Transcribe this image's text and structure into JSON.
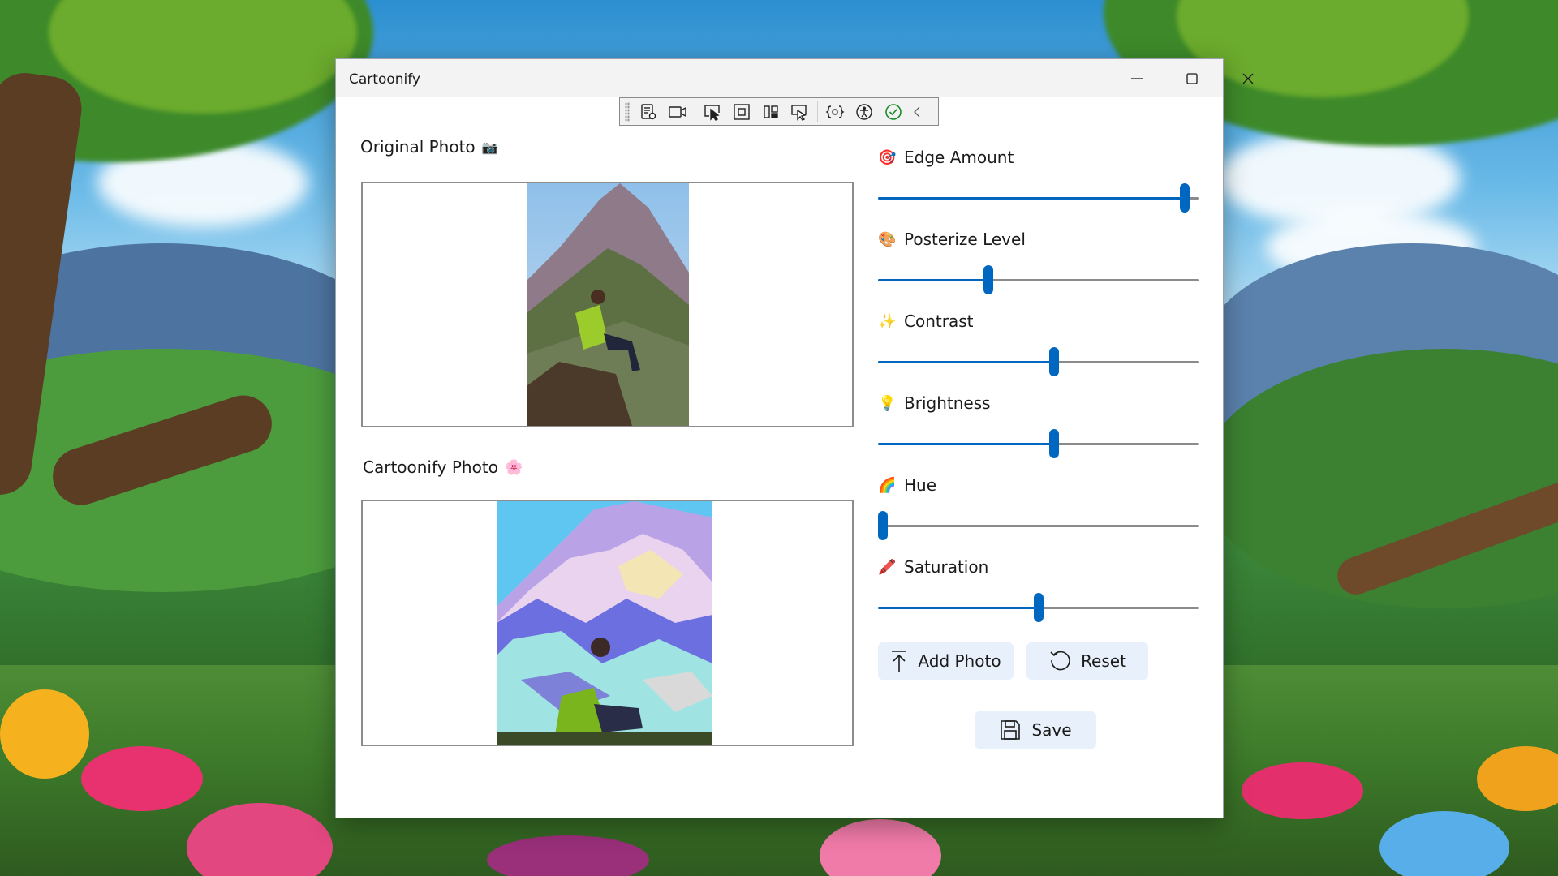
{
  "window": {
    "title": "Cartoonify",
    "controls": [
      "minimize",
      "maximize",
      "close"
    ]
  },
  "devtoolbar": {
    "icons": [
      "live-visual-tree-icon",
      "record-icon",
      "select-element-icon",
      "display-layout-adorners-icon",
      "track-focus-icon",
      "binding-failures-icon",
      "hot-reload-icon",
      "accessibility-checker-icon",
      "check-icon",
      "collapse-chevron-icon"
    ]
  },
  "original": {
    "label": "Original Photo",
    "icon": "📷"
  },
  "cartoon": {
    "label": "Cartoonify Photo",
    "icon": "🌸"
  },
  "sliders": [
    {
      "label": "Edge Amount",
      "icon": "🎯",
      "value": 0.97
    },
    {
      "label": "Posterize Level",
      "icon": "🎨",
      "value": 0.34
    },
    {
      "label": "Contrast",
      "icon": "✨",
      "value": 0.55
    },
    {
      "label": "Brightness",
      "icon": "💡",
      "value": 0.55
    },
    {
      "label": "Hue",
      "icon": "🌈",
      "value": 0.0
    },
    {
      "label": "Saturation",
      "icon": "🖍️",
      "value": 0.5
    }
  ],
  "buttons": {
    "add_photo": "Add Photo",
    "reset": "Reset",
    "save": "Save"
  },
  "colors": {
    "accent": "#0067c0",
    "button_bg": "#e8f1fb"
  }
}
